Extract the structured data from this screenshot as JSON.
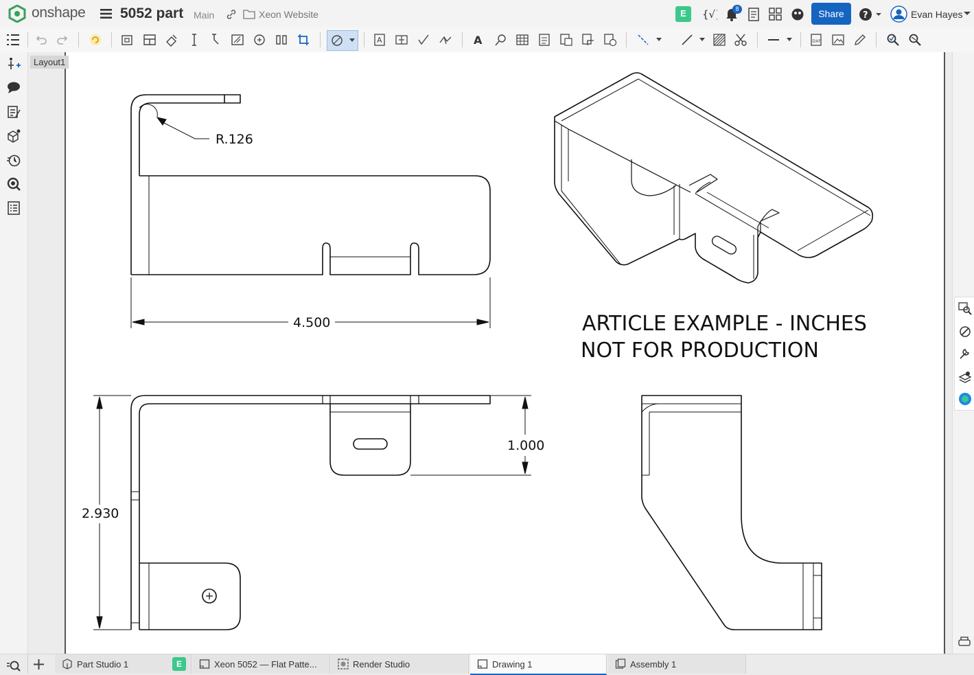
{
  "app": {
    "logo_text": "onshape",
    "doc_title": "5052 part",
    "branch": "Main",
    "folder": "Xeon Website",
    "share_label": "Share",
    "user_name": "Evan Hayes",
    "notifications_count": "8",
    "e_badge": "E",
    "brand_color": "#1565c0"
  },
  "sheet": {
    "layout_label": "Layout1"
  },
  "drawing": {
    "dim_radius": "R.126",
    "dim_width": "4.500",
    "dim_height": "2.930",
    "dim_tab": "1.000",
    "note_line1": "ARTICLE EXAMPLE - INCHES",
    "note_line2": "NOT FOR PRODUCTION"
  },
  "tabs": [
    {
      "label": "Part Studio 1",
      "icon": "part-studio-icon"
    },
    {
      "label": "Xeon 5052 — Flat Patte...",
      "icon": "drawing-icon"
    },
    {
      "label": "Render Studio",
      "icon": "render-studio-icon"
    },
    {
      "label": "Drawing 1",
      "icon": "drawing-icon",
      "active": true
    },
    {
      "label": "Assembly 1",
      "icon": "assembly-icon"
    }
  ]
}
